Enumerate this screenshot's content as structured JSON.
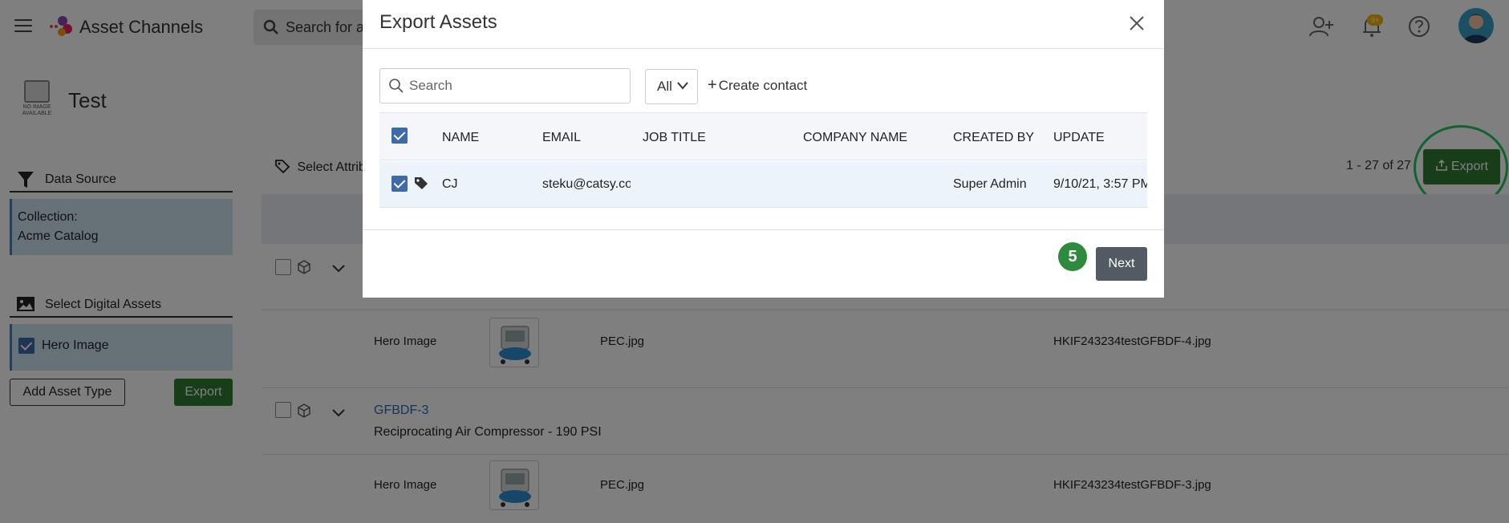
{
  "topbar": {
    "app_title": "Asset Channels",
    "search_placeholder": "Search for a",
    "notification_count": "9+"
  },
  "page": {
    "title": "Test",
    "no_image_caption": "NO IMAGE AVAILABLE"
  },
  "left_panel": {
    "data_source_label": "Data Source",
    "collection_label": "Collection:",
    "collection_value": "Acme Catalog",
    "digital_assets_label": "Select Digital Assets",
    "hero_image_label": "Hero Image",
    "add_asset_type_label": "Add Asset Type",
    "export_label": "Export"
  },
  "main": {
    "select_attributes_label": "Select Attrib",
    "pagination": "1 - 27 of 27",
    "export_label": "Export",
    "rows": [
      {
        "asset_type": "Hero Image",
        "file": "PEC.jpg",
        "filename": "HKIF243234testGFBDF-4.jpg"
      },
      {
        "sku": "GFBDF-3",
        "description": "Reciprocating Air Compressor - 190 PSI",
        "asset_type": "Hero Image",
        "file": "PEC.jpg",
        "filename": "HKIF243234testGFBDF-3.jpg"
      }
    ]
  },
  "modal": {
    "title": "Export Assets",
    "search_placeholder": "Search",
    "filter_value": "All",
    "create_contact_label": "Create contact",
    "columns": [
      "NAME",
      "EMAIL",
      "JOB TITLE",
      "COMPANY NAME",
      "CREATED BY",
      "UPDATE"
    ],
    "contacts": [
      {
        "name": "CJ",
        "email": "steku@catsy.com",
        "job_title": "",
        "company_name": "",
        "created_by": "Super Admin",
        "updated": "9/10/21, 3:57 PM"
      }
    ],
    "step_number": "5",
    "next_label": "Next"
  }
}
